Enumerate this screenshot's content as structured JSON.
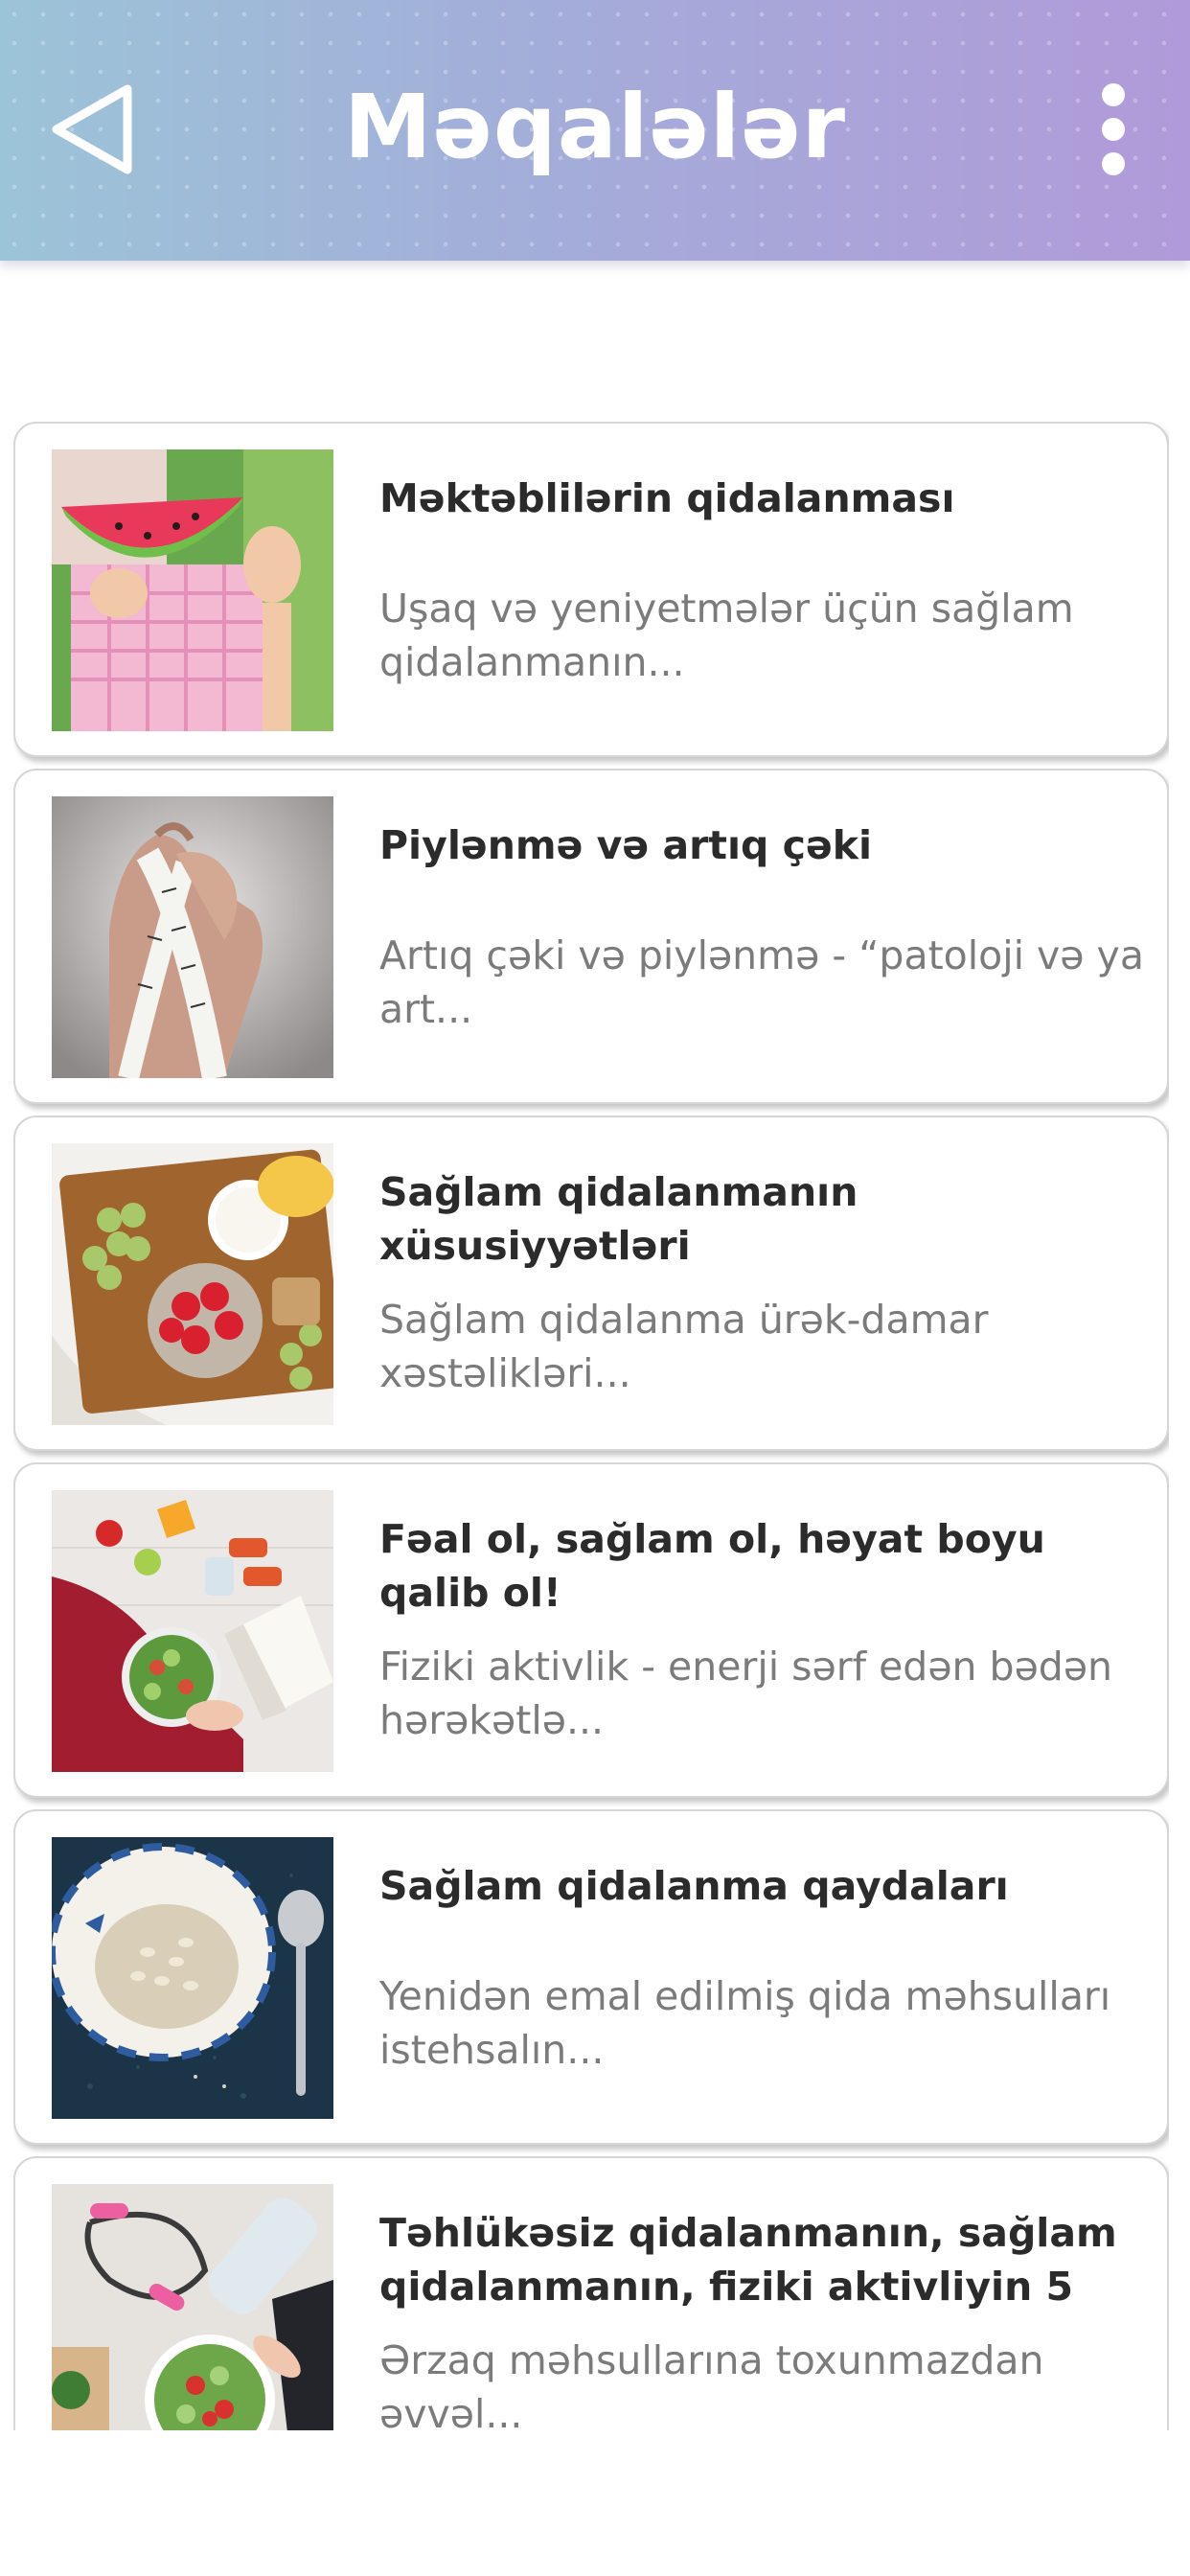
{
  "header": {
    "title": "Məqalələr",
    "back_icon": "back-triangle-icon",
    "menu_icon": "more-vertical-icon",
    "gradient_colors": [
      "#9cc4d8",
      "#b19ad9"
    ]
  },
  "articles": [
    {
      "title": "Məktəblilərin qidalanması",
      "description": "Uşaq və yeniyetmələr üçün sağlam qidalanmanın...",
      "image": "child-eating-watermelon"
    },
    {
      "title": "Piylənmə və artıq çəki",
      "description": "Artıq çəki və piylənmə - “patoloji və ya art...",
      "image": "hand-holding-measuring-tape"
    },
    {
      "title": "Sağlam qidalanmanın xüsusiyyətləri",
      "description": "Sağlam qidalanma ürək-damar xəstəlikləri...",
      "image": "healthy-food-tray"
    },
    {
      "title": "Fəal ol, sağlam ol, həyat boyu qalib ol!",
      "description": "Fiziki aktivlik - enerji sərf edən bədən hərəkətlə...",
      "image": "salad-and-dumbbells"
    },
    {
      "title": "Sağlam qidalanma qaydaları",
      "description": "Yenidən emal edilmiş qida məhsulları istehsalın...",
      "image": "oats-bowl-and-spoon"
    },
    {
      "title": "Təhlükəsiz qidalanmanın, sağlam qidalanmanın, fiziki aktivliyin 5",
      "description": "Ərzaq məhsullarına toxunmazdan əvvəl...",
      "image": "jump-rope-and-salad"
    }
  ]
}
